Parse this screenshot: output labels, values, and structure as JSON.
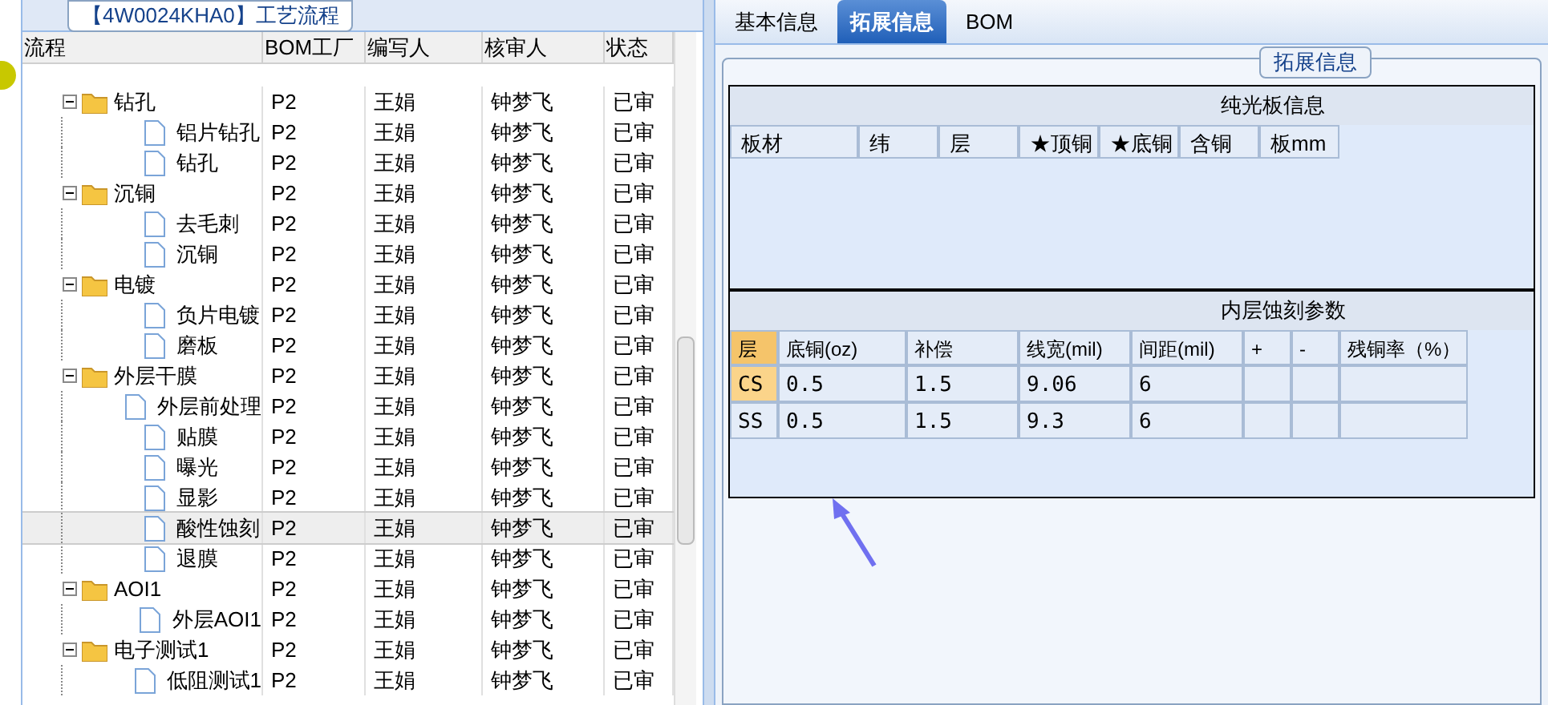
{
  "left_panel": {
    "title": "【4W0024KHA0】工艺流程",
    "columns": [
      "流程",
      "BOM工厂",
      "编写人",
      "核审人",
      "状态"
    ],
    "tree": [
      {
        "label": "钻孔",
        "bom": "P2",
        "writer": "王娟",
        "reviewer": "钟梦飞",
        "status": "已审",
        "expanded": true,
        "selected": false,
        "children": [
          {
            "label": "铝片钻孔",
            "bom": "P2",
            "writer": "王娟",
            "reviewer": "钟梦飞",
            "status": "已审",
            "selected": false
          },
          {
            "label": "钻孔",
            "bom": "P2",
            "writer": "王娟",
            "reviewer": "钟梦飞",
            "status": "已审",
            "selected": false
          }
        ]
      },
      {
        "label": "沉铜",
        "bom": "P2",
        "writer": "王娟",
        "reviewer": "钟梦飞",
        "status": "已审",
        "expanded": true,
        "selected": false,
        "children": [
          {
            "label": "去毛刺",
            "bom": "P2",
            "writer": "王娟",
            "reviewer": "钟梦飞",
            "status": "已审",
            "selected": false
          },
          {
            "label": "沉铜",
            "bom": "P2",
            "writer": "王娟",
            "reviewer": "钟梦飞",
            "status": "已审",
            "selected": false
          }
        ]
      },
      {
        "label": "电镀",
        "bom": "P2",
        "writer": "王娟",
        "reviewer": "钟梦飞",
        "status": "已审",
        "expanded": true,
        "selected": false,
        "children": [
          {
            "label": "负片电镀",
            "bom": "P2",
            "writer": "王娟",
            "reviewer": "钟梦飞",
            "status": "已审",
            "selected": false
          },
          {
            "label": "磨板",
            "bom": "P2",
            "writer": "王娟",
            "reviewer": "钟梦飞",
            "status": "已审",
            "selected": false
          }
        ]
      },
      {
        "label": "外层干膜",
        "bom": "P2",
        "writer": "王娟",
        "reviewer": "钟梦飞",
        "status": "已审",
        "expanded": true,
        "selected": false,
        "children": [
          {
            "label": "外层前处理",
            "bom": "P2",
            "writer": "王娟",
            "reviewer": "钟梦飞",
            "status": "已审",
            "selected": false
          },
          {
            "label": "贴膜",
            "bom": "P2",
            "writer": "王娟",
            "reviewer": "钟梦飞",
            "status": "已审",
            "selected": false
          },
          {
            "label": "曝光",
            "bom": "P2",
            "writer": "王娟",
            "reviewer": "钟梦飞",
            "status": "已审",
            "selected": false
          },
          {
            "label": "显影",
            "bom": "P2",
            "writer": "王娟",
            "reviewer": "钟梦飞",
            "status": "已审",
            "selected": false
          },
          {
            "label": "酸性蚀刻",
            "bom": "P2",
            "writer": "王娟",
            "reviewer": "钟梦飞",
            "status": "已审",
            "selected": true
          },
          {
            "label": "退膜",
            "bom": "P2",
            "writer": "王娟",
            "reviewer": "钟梦飞",
            "status": "已审",
            "selected": false
          }
        ]
      },
      {
        "label": "AOI1",
        "bom": "P2",
        "writer": "王娟",
        "reviewer": "钟梦飞",
        "status": "已审",
        "expanded": true,
        "selected": false,
        "children": [
          {
            "label": "外层AOI1",
            "bom": "P2",
            "writer": "王娟",
            "reviewer": "钟梦飞",
            "status": "已审",
            "selected": false
          }
        ]
      },
      {
        "label": "电子测试1",
        "bom": "P2",
        "writer": "王娟",
        "reviewer": "钟梦飞",
        "status": "已审",
        "expanded": true,
        "selected": false,
        "children": [
          {
            "label": "低阻测试1",
            "bom": "P2",
            "writer": "王娟",
            "reviewer": "钟梦飞",
            "status": "已审",
            "selected": false
          }
        ]
      }
    ]
  },
  "tabs": [
    {
      "label": "基本信息",
      "selected": false
    },
    {
      "label": "拓展信息",
      "selected": true
    },
    {
      "label": "BOM",
      "selected": false
    }
  ],
  "group_title": "拓展信息",
  "board_table": {
    "title": "纯光板信息",
    "columns": [
      "板材",
      "纬",
      "层",
      "★顶铜",
      "★底铜",
      "含铜",
      "板mm"
    ]
  },
  "etch_table": {
    "title": "内层蚀刻参数",
    "columns": [
      "层",
      "底铜(oz)",
      "补偿",
      "线宽(mil)",
      "间距(mil)",
      "+",
      "-",
      "残铜率（%）"
    ],
    "rows": [
      {
        "cells": [
          "CS",
          "0.5",
          "1.5",
          "9.06",
          "6",
          "",
          "",
          ""
        ],
        "selected": true
      },
      {
        "cells": [
          "SS",
          "0.5",
          "1.5",
          "9.3",
          "6",
          "",
          "",
          ""
        ],
        "selected": false
      }
    ]
  }
}
